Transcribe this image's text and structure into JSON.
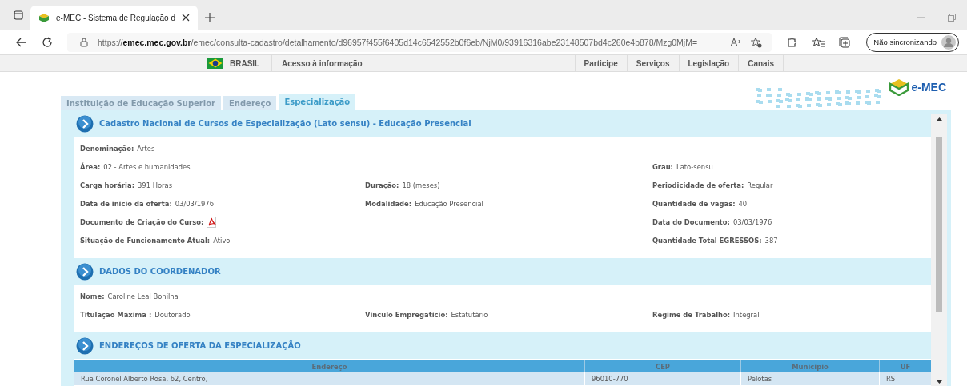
{
  "browser": {
    "tab_title": "e-MEC - Sistema de Regulação d",
    "url": "https://**emec.mec.gov.br**/emec/consulta-cadastro/detalhamento/d96957f455f6405d14c6542552b0f6eb/NjM0/93916316abe23148507bd4c260e4b878/Mzg0MjM=",
    "profile": "Não sincronizando"
  },
  "gov_bar": {
    "brand": "BRASIL",
    "left_links": [
      "Acesso à informação"
    ],
    "right_links": [
      "Participe",
      "Serviços",
      "Legislação",
      "Canais"
    ]
  },
  "logo": "e-MEC",
  "tabs": [
    {
      "label": "Instituição de Educação Superior",
      "selected": false
    },
    {
      "label": "Endereço",
      "selected": false
    },
    {
      "label": "Especialização",
      "selected": true
    }
  ],
  "sections": [
    {
      "title": "Cadastro Nacional de Cursos de Especialização (Lato sensu) - Educação Presencial",
      "rows": [
        {
          "left": {
            "label": "Denominação:",
            "value": "Artes"
          }
        },
        {
          "left": {
            "label": "Área:",
            "value": "02 - Artes e humanidades"
          },
          "right": {
            "label": "Grau:",
            "value": "Lato-sensu"
          }
        },
        {
          "left": {
            "label": "Carga horária:",
            "value": "391 Horas"
          },
          "middle": {
            "label": "Duração:",
            "value": "18 (meses)"
          },
          "right": {
            "label": "Periodicidade de oferta:",
            "value": "Regular"
          }
        },
        {
          "left": {
            "label": "Data de início da oferta:",
            "value": "03/03/1976"
          },
          "middle": {
            "label": "Modalidade:",
            "value": "Educação Presencial"
          },
          "right": {
            "label": "Quantidade de vagas:",
            "value": "40"
          }
        },
        {
          "left": {
            "label": "Documento de Criação do Curso:",
            "kind": "pdf"
          },
          "right": {
            "label": "Data do Documento:",
            "value": "03/03/1976"
          }
        },
        {
          "left": {
            "label": "Situação de Funcionamento Atual:",
            "value": "Ativo"
          },
          "right": {
            "label": "Quantidade Total EGRESSOS:",
            "value": "387"
          }
        }
      ]
    },
    {
      "title": "DADOS DO COORDENADOR",
      "rows": [
        {
          "left": {
            "label": "Nome:",
            "value": "Caroline Leal Bonilha"
          }
        },
        {
          "left": {
            "label": "Titulação Máxima :",
            "value": "Doutorado"
          },
          "middle": {
            "label": "Vínculo Empregatício:",
            "value": "Estatutário"
          },
          "right": {
            "label": "Regime de Trabalho:",
            "value": "Integral"
          }
        }
      ]
    },
    {
      "title": "ENDEREÇOS DE OFERTA DA ESPECIALIZAÇÃO",
      "table": {
        "columns": [
          "Endereço",
          "CEP",
          "Município",
          "UF"
        ],
        "rows": [
          [
            "Rua Coronel Alberto Rosa, 62, Centro,",
            "96010-770",
            "Pelotas",
            "RS"
          ]
        ]
      }
    }
  ]
}
